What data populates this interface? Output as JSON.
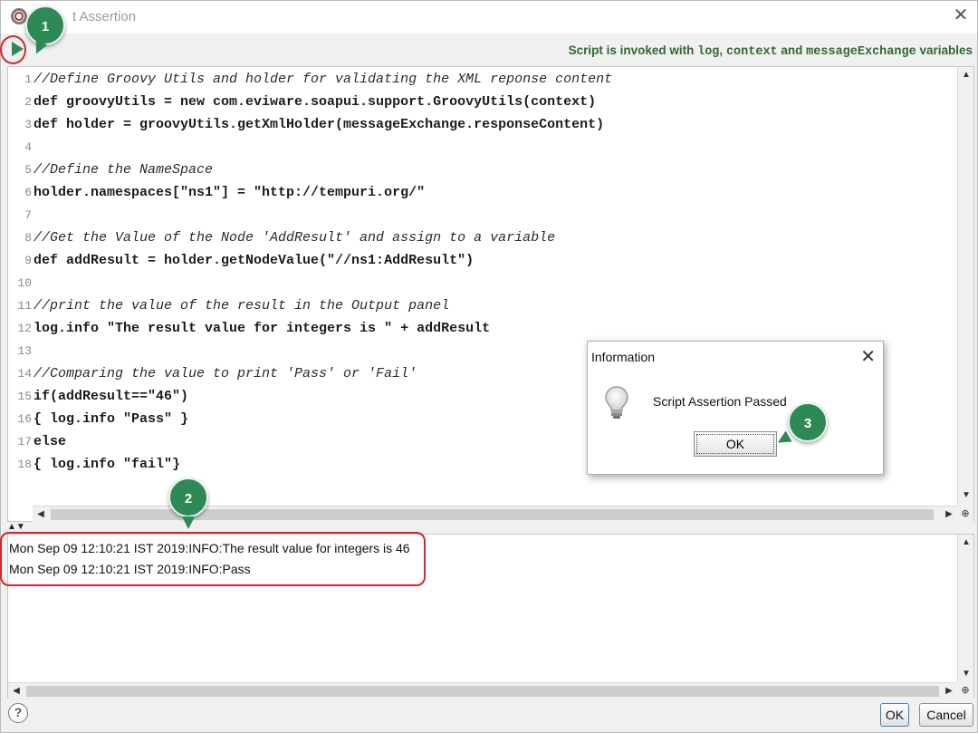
{
  "window": {
    "title": "Script Assertion",
    "title_visible": "t Assertion",
    "close_icon": "close-icon"
  },
  "toolbar": {
    "run_icon": "play-icon",
    "info_prefix": "Script is invoked with ",
    "info_var1": "log",
    "info_sep1": ", ",
    "info_var2": "context",
    "info_sep2": " and ",
    "info_var3": "messageExchange",
    "info_suffix": " variables"
  },
  "editor": {
    "line_numbers": [
      "1",
      "2",
      "3",
      "4",
      "5",
      "6",
      "7",
      "8",
      "9",
      "10",
      "11",
      "12",
      "13",
      "14",
      "15",
      "16",
      "17",
      "18"
    ],
    "lines": [
      "//Define Groovy Utils and holder for validating the XML reponse content",
      "def groovyUtils = new com.eviware.soapui.support.GroovyUtils(context)",
      "def holder = groovyUtils.getXmlHolder(messageExchange.responseContent)",
      "",
      "//Define the NameSpace",
      "holder.namespaces[\"ns1\"] = \"http://tempuri.org/\"",
      "",
      "//Get the Value of the Node 'AddResult' and assign to a variable",
      "def addResult = holder.getNodeValue(\"//ns1:AddResult\")",
      "",
      "//print the value of the result in the Output panel",
      "log.info \"The result value for integers is \" + addResult",
      "",
      "//Comparing the value to print 'Pass' or 'Fail'",
      "if(addResult==\"46\")",
      "{ log.info \"Pass\" }",
      "else",
      "{ log.info \"fail\"}"
    ]
  },
  "log": {
    "entries": [
      "Mon Sep 09 12:10:21 IST 2019:INFO:The result value for integers is 46",
      "Mon Sep 09 12:10:21 IST 2019:INFO:Pass"
    ]
  },
  "dialog": {
    "title": "Information",
    "message": "Script Assertion Passed",
    "ok_label": "OK",
    "icon": "lightbulb-icon"
  },
  "footer": {
    "help_label": "?",
    "ok_label": "OK",
    "cancel_label": "Cancel"
  },
  "markers": [
    "1",
    "2",
    "3"
  ],
  "colors": {
    "marker": "#2d8a55",
    "highlight": "#cc2b2b",
    "toolbar_info": "#2e6b2e"
  }
}
